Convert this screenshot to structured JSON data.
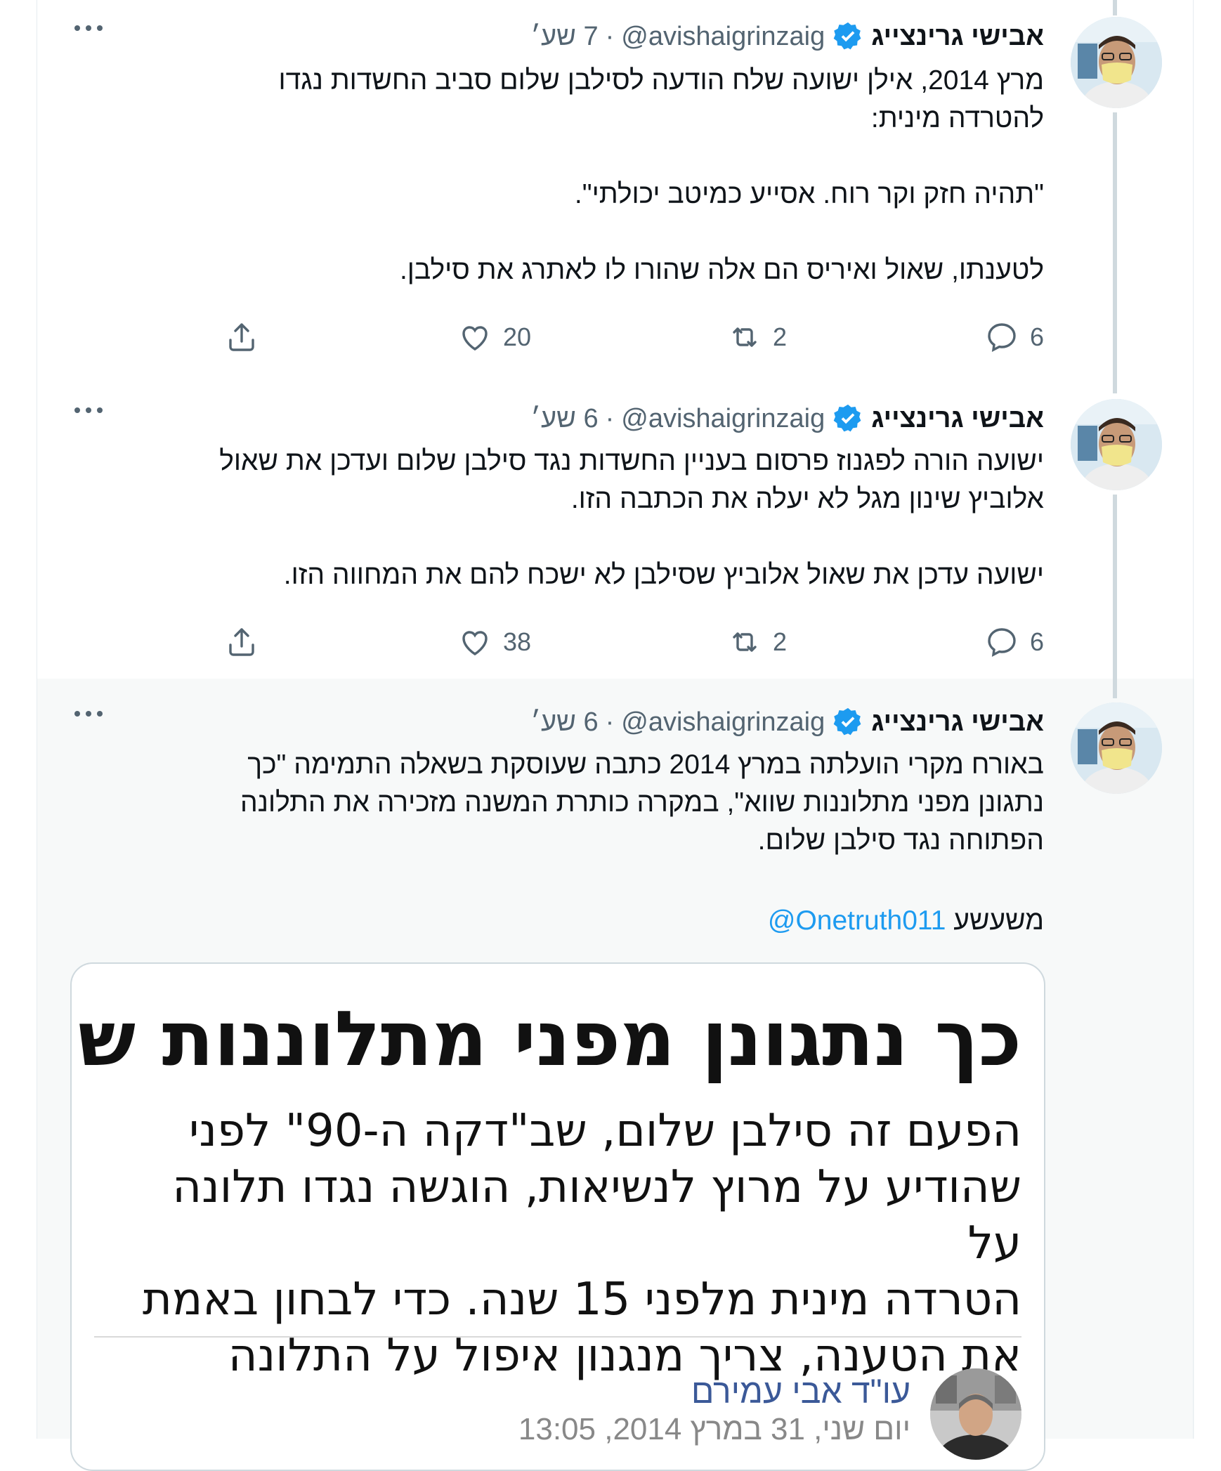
{
  "colors": {
    "accent": "#1d9bf0",
    "text_primary": "#0f1419",
    "text_secondary": "#536471",
    "highlight_bg": "#f7f9f9",
    "thread_line": "#cfd9de"
  },
  "tweets": [
    {
      "author_name": "אבישי גרינצייג",
      "handle": "@avishaigrinzaig",
      "separator": "·",
      "time": "7 שע׳",
      "text": "מרץ 2014, אילן ישועה שלח הודעה לסילבן שלום סביב החשדות נגדו\nלהטרדה מינית:\n\n\"תהיה חזק וקר רוח. אסייע כמיטב יכולתי\".\n\nלטענתו, שאול ואיריס הם אלה שהורו לו לאתרג את סילבן.",
      "replies": "6",
      "retweets": "2",
      "likes": "20",
      "icons": {
        "verified": "verified-badge-icon",
        "more": "more-icon",
        "reply": "reply-icon",
        "retweet": "retweet-icon",
        "like": "heart-icon",
        "share": "share-icon"
      }
    },
    {
      "author_name": "אבישי גרינצייג",
      "handle": "@avishaigrinzaig",
      "separator": "·",
      "time": "6 שע׳",
      "text": "ישועה הורה לפגנוז פרסום בעניין החשדות נגד סילבן שלום ועדכן את שאול\nאלוביץ שינון מגל לא יעלה את הכתבה הזו.\n\nישועה עדכן את שאול אלוביץ שסילבן לא ישכח להם את המחווה הזו.",
      "replies": "6",
      "retweets": "2",
      "likes": "38"
    },
    {
      "author_name": "אבישי גרינצייג",
      "handle": "@avishaigrinzaig",
      "separator": "·",
      "time": "6 שע׳",
      "text": "באורח מקרי הועלתה במרץ 2014 כתבה שעוסקת בשאלה התמימה \"כך\nנתגונן מפני מתלוננות שווא\", במקרה כותרת המשנה מזכירה את התלונה\nהפתוחה נגד סילבן שלום.",
      "mention_prefix": "משעשע",
      "mention": "@Onetruth011"
    }
  ],
  "quoted_card": {
    "headline": "כך נתגונן מפני מתלוננות שווא",
    "body": "הפעם זה סילבן שלום, שב\"דקה ה-90\" לפני\nשהודיע על מרוץ לנשיאות, הוגשה נגדו תלונה על\nהטרדה מינית מלפני 15 שנה. כדי לבחון באמת\nאת הטענה, צריך מנגנון איפול על התלונה",
    "author": "עו\"ד אבי עמירם",
    "date": "יום שני, 31 במרץ 2014, 13:05"
  }
}
